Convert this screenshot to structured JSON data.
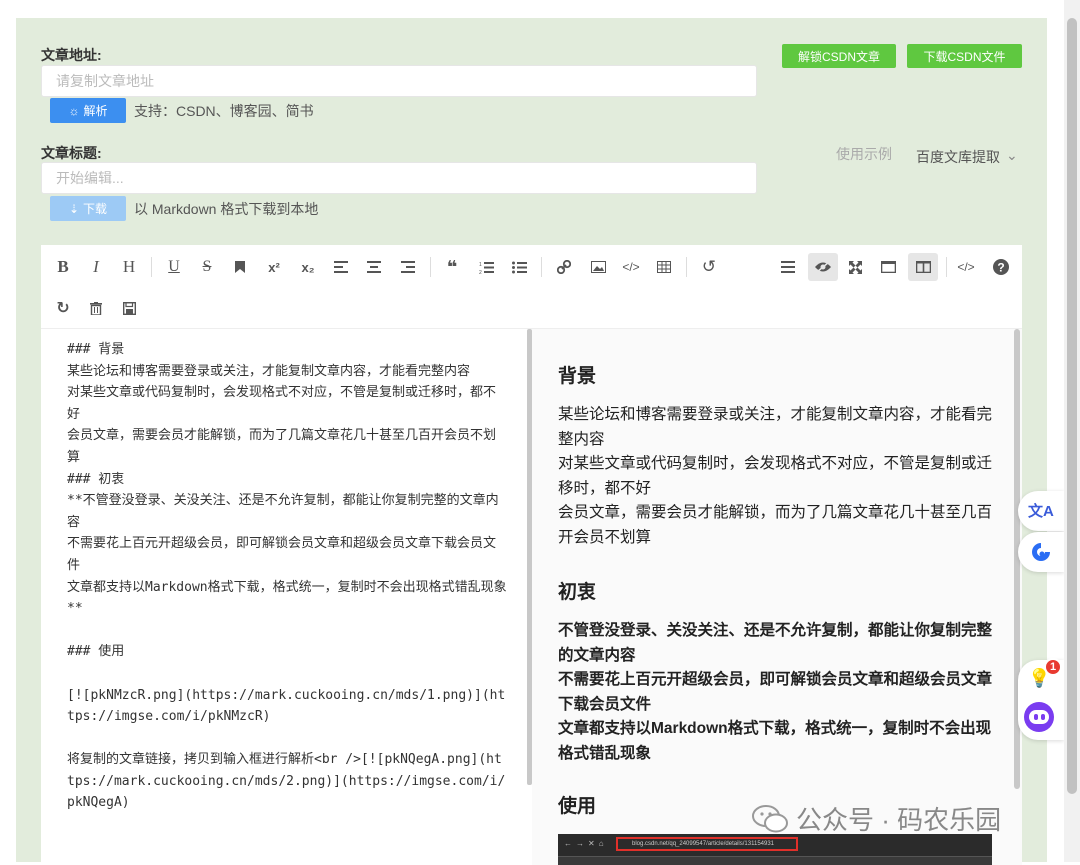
{
  "form": {
    "url_label": "文章地址:",
    "url_placeholder": "请复制文章地址",
    "parse_button": "解析",
    "support_text": "支持：CSDN、博客园、简书",
    "title_label": "文章标题:",
    "title_placeholder": "开始编辑...",
    "download_button": "下载",
    "download_hint": "以 Markdown 格式下载到本地"
  },
  "actions": {
    "unlock_csdn": "解锁CSDN文章",
    "download_csdn": "下载CSDN文件",
    "usage_example": "使用示例",
    "baidu_extract": "百度文库提取"
  },
  "editor": {
    "source_text": "### 背景\n某些论坛和博客需要登录或关注，才能复制文章内容，才能看完整内容\n对某些文章或代码复制时，会发现格式不对应，不管是复制或迁移时，都不好\n会员文章，需要会员才能解锁，而为了几篇文章花几十甚至几百开会员不划算\n### 初衷\n**不管登没登录、关没关注、还是不允许复制，都能让你复制完整的文章内容\n不需要花上百元开超级会员，即可解锁会员文章和超级会员文章下载会员文件\n文章都支持以Markdown格式下载，格式统一，复制时不会出现格式错乱现象**\n\n### 使用\n\n[![pkNMzcR.png](https://mark.cuckooing.cn/mds/1.png)](https://imgse.com/i/pkNMzcR)\n\n将复制的文章链接，拷贝到输入框进行解析<br />[![pkNQegA.png](https://mark.cuckooing.cn/mds/2.png)](https://imgse.com/i/pkNQegA)",
    "preview": {
      "h_background": "背景",
      "bg_p1": "某些论坛和博客需要登录或关注，才能复制文章内容，才能看完整内容",
      "bg_p2": "对某些文章或代码复制时，会发现格式不对应，不管是复制或迁移时，都不好",
      "bg_p3": "会员文章，需要会员才能解锁，而为了几篇文章花几十甚至几百开会员不划算",
      "h_intent": "初衷",
      "in_p1": "不管登没登录、关没关注、还是不允许复制，都能让你复制完整的文章内容",
      "in_p2": "不需要花上百元开超级会员，即可解锁会员文章和超级会员文章下载会员文件",
      "in_p3": "文章都支持以Markdown格式下载，格式统一，复制时不会出现格式错乱现象",
      "h_usage": "使用",
      "screenshot_url": "blog.csdn.net/qq_24099547/article/details/131154931"
    }
  },
  "toolbar_icons": [
    "B",
    "I",
    "H",
    "U",
    "S",
    "bookmark",
    "x²",
    "x₂",
    "align-left",
    "align-center",
    "align-right",
    "quote",
    "ordered-list",
    "unordered-list",
    "link",
    "image",
    "code",
    "table",
    "undo",
    "menu",
    "preview",
    "fullscreen",
    "window",
    "columns",
    "html",
    "help",
    "redo",
    "trash",
    "save"
  ],
  "floating": {
    "badge_count": "1"
  },
  "watermark": "公众号 · 码农乐园",
  "colors": {
    "page_bg": "#e2ecdc",
    "green": "#5fc840",
    "blue": "#3c8ff0",
    "blue_disabled": "#9dcaf5"
  }
}
